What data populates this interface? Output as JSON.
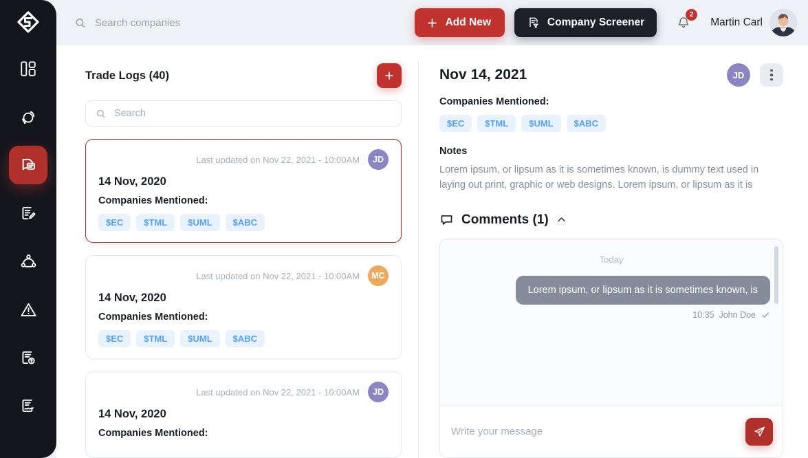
{
  "brand": {
    "accent": "#c0332e",
    "dark": "#15161d",
    "tag_bg": "#e9f3ff",
    "tag_fg": "#55a0f6"
  },
  "sidebar": {
    "logo_name": "app-logo",
    "items": [
      {
        "icon": "dashboard-icon",
        "active": false
      },
      {
        "icon": "target-refresh-icon",
        "active": false
      },
      {
        "icon": "trade-log-icon",
        "active": true
      },
      {
        "icon": "document-edit-icon",
        "active": false
      },
      {
        "icon": "people-network-icon",
        "active": false
      },
      {
        "icon": "alert-triangle-icon",
        "active": false
      },
      {
        "icon": "document-help-icon",
        "active": false
      },
      {
        "icon": "document-signature-icon",
        "active": false
      }
    ]
  },
  "topbar": {
    "search_placeholder": "Search companies",
    "search_value": "",
    "add_new_label": "Add New",
    "company_screener_label": "Company Screener",
    "notification_count": "2",
    "user_name": "Martin Carl"
  },
  "left_pane": {
    "title": "Trade Logs (40)",
    "add_button_label": "+",
    "search_placeholder": "Search",
    "search_value": "",
    "companies_label": "Companies Mentioned:",
    "cards": [
      {
        "updated": "Last updated on Nov 22, 2021 - 10:00AM",
        "avatar_initials": "JD",
        "avatar_color": "#8b85c1",
        "date": "14 Nov, 2020",
        "companies_label": "Companies Mentioned:",
        "tags": [
          "$EC",
          "$TML",
          "$UML",
          "$ABC"
        ],
        "selected": true
      },
      {
        "updated": "Last updated on Nov 22, 2021 - 10:00AM",
        "avatar_initials": "MC",
        "avatar_color": "#efa95c",
        "date": "14 Nov, 2020",
        "companies_label": "Companies Mentioned:",
        "tags": [
          "$EC",
          "$TML",
          "$UML",
          "$ABC"
        ],
        "selected": false
      },
      {
        "updated": "Last updated on Nov 22, 2021 - 10:00AM",
        "avatar_initials": "JD",
        "avatar_color": "#8b85c1",
        "date": "14 Nov, 2020",
        "companies_label": "Companies Mentioned:",
        "tags": [],
        "selected": false
      }
    ]
  },
  "right_pane": {
    "title": "Nov 14, 2021",
    "avatar_initials": "JD",
    "companies_label": "Companies Mentioned:",
    "tags": [
      "$EC",
      "$TML",
      "$UML",
      "$ABC"
    ],
    "notes_title": "Notes",
    "notes_body": "Lorem ipsum, or lipsum as it is sometimes known, is dummy text used in laying out print, graphic or web designs. Lorem ipsum, or lipsum as it is",
    "comments_title": "Comments (1)",
    "chat": {
      "day_label": "Today",
      "messages": [
        {
          "text": "Lorem ipsum, or lipsum as it is sometimes known, is",
          "time": "10:35",
          "author": "John Doe",
          "status": "read"
        }
      ],
      "input_placeholder": "Write your message",
      "input_value": ""
    }
  }
}
